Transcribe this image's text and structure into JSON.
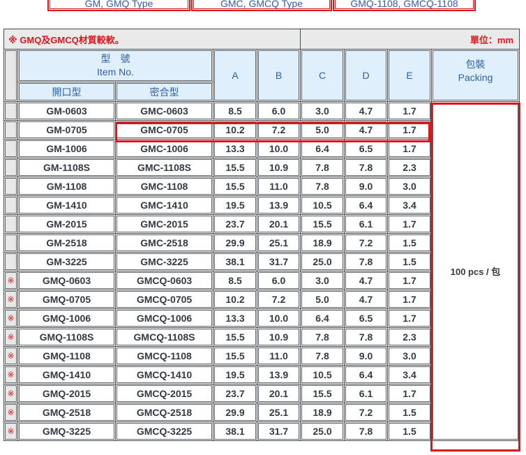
{
  "tabs": [
    "GM, GMQ Type",
    "GMC, GMCQ Type",
    "GMQ-1108, GMCQ-1108"
  ],
  "table": {
    "title": "※ GMQ及GMCQ材質較軟。",
    "unit": "單位：mm",
    "header": {
      "item_no_zh": "型　號",
      "item_no_en": "Item No.",
      "open_type": "開口型",
      "closed_type": "密合型",
      "A": "A",
      "B": "B",
      "C": "C",
      "D": "D",
      "E": "E",
      "packing_zh": "包裝",
      "packing_en": "Packing"
    },
    "packing_value": "100 pcs / 包",
    "rows": [
      {
        "mark": "",
        "open": "GM-0603",
        "closed": "GMC-0603",
        "A": "8.5",
        "B": "6.0",
        "C": "3.0",
        "D": "4.7",
        "E": "1.7"
      },
      {
        "mark": "",
        "open": "GM-0705",
        "closed": "GMC-0705",
        "A": "10.2",
        "B": "7.2",
        "C": "5.0",
        "D": "4.7",
        "E": "1.7"
      },
      {
        "mark": "",
        "open": "GM-1006",
        "closed": "GMC-1006",
        "A": "13.3",
        "B": "10.0",
        "C": "6.4",
        "D": "6.5",
        "E": "1.7"
      },
      {
        "mark": "",
        "open": "GM-1108S",
        "closed": "GMC-1108S",
        "A": "15.5",
        "B": "10.9",
        "C": "7.8",
        "D": "7.8",
        "E": "2.3"
      },
      {
        "mark": "",
        "open": "GM-1108",
        "closed": "GMC-1108",
        "A": "15.5",
        "B": "11.0",
        "C": "7.8",
        "D": "9.0",
        "E": "3.0"
      },
      {
        "mark": "",
        "open": "GM-1410",
        "closed": "GMC-1410",
        "A": "19.5",
        "B": "13.9",
        "C": "10.5",
        "D": "6.4",
        "E": "3.4"
      },
      {
        "mark": "",
        "open": "GM-2015",
        "closed": "GMC-2015",
        "A": "23.7",
        "B": "20.1",
        "C": "15.5",
        "D": "6.1",
        "E": "1.7"
      },
      {
        "mark": "",
        "open": "GM-2518",
        "closed": "GMC-2518",
        "A": "29.9",
        "B": "25.1",
        "C": "18.9",
        "D": "7.2",
        "E": "1.5"
      },
      {
        "mark": "",
        "open": "GM-3225",
        "closed": "GMC-3225",
        "A": "38.1",
        "B": "31.7",
        "C": "25.0",
        "D": "7.8",
        "E": "1.5"
      },
      {
        "mark": "※",
        "open": "GMQ-0603",
        "closed": "GMCQ-0603",
        "A": "8.5",
        "B": "6.0",
        "C": "3.0",
        "D": "4.7",
        "E": "1.7"
      },
      {
        "mark": "※",
        "open": "GMQ-0705",
        "closed": "GMCQ-0705",
        "A": "10.2",
        "B": "7.2",
        "C": "5.0",
        "D": "4.7",
        "E": "1.7"
      },
      {
        "mark": "※",
        "open": "GMQ-1006",
        "closed": "GMCQ-1006",
        "A": "13.3",
        "B": "10.0",
        "C": "6.4",
        "D": "6.5",
        "E": "1.7"
      },
      {
        "mark": "※",
        "open": "GMQ-1108S",
        "closed": "GMCQ-1108S",
        "A": "15.5",
        "B": "10.9",
        "C": "7.8",
        "D": "7.8",
        "E": "2.3"
      },
      {
        "mark": "※",
        "open": "GMQ-1108",
        "closed": "GMCQ-1108",
        "A": "15.5",
        "B": "11.0",
        "C": "7.8",
        "D": "9.0",
        "E": "3.0"
      },
      {
        "mark": "※",
        "open": "GMQ-1410",
        "closed": "GMCQ-1410",
        "A": "19.5",
        "B": "13.9",
        "C": "10.5",
        "D": "6.4",
        "E": "3.4"
      },
      {
        "mark": "※",
        "open": "GMQ-2015",
        "closed": "GMCQ-2015",
        "A": "23.7",
        "B": "20.1",
        "C": "15.5",
        "D": "6.1",
        "E": "1.7"
      },
      {
        "mark": "※",
        "open": "GMQ-2518",
        "closed": "GMCQ-2518",
        "A": "29.9",
        "B": "25.1",
        "C": "18.9",
        "D": "7.2",
        "E": "1.5"
      },
      {
        "mark": "※",
        "open": "GMQ-3225",
        "closed": "GMCQ-3225",
        "A": "38.1",
        "B": "31.7",
        "C": "25.0",
        "D": "7.8",
        "E": "1.5"
      }
    ]
  },
  "colors": {
    "accent_red": "#e0141b",
    "header_blue_text": "#2f5fa8",
    "header_bg": "#dff0fc"
  }
}
